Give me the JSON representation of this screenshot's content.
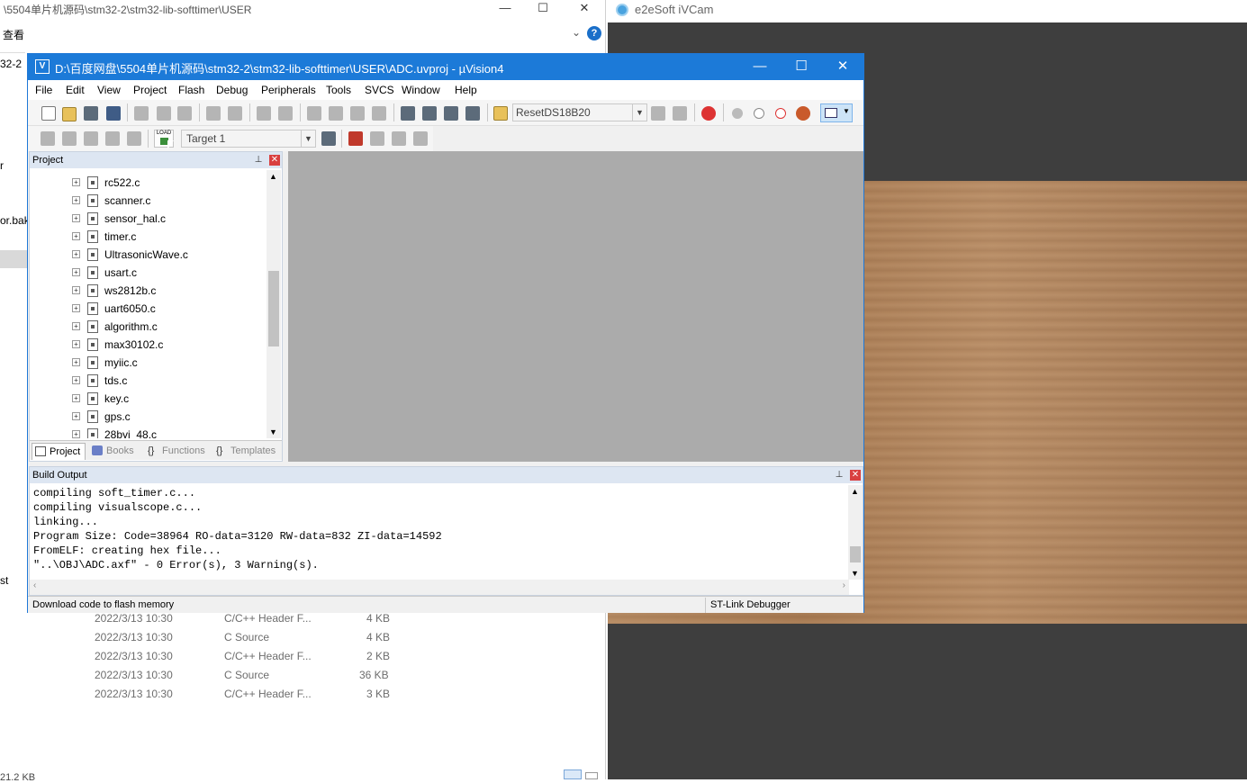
{
  "explorer": {
    "title": "\\5504单片机源码\\stm32-2\\stm32-lib-softtimer\\USER",
    "ribbon_view": "查看",
    "sidebar_fragments": [
      "32-2",
      "r",
      "or.bak",
      "st"
    ],
    "files": [
      {
        "date": "2022/3/13 10:30",
        "type": "C/C++ Header F...",
        "size": "4 KB"
      },
      {
        "date": "2022/3/13 10:30",
        "type": "C Source",
        "size": "4 KB"
      },
      {
        "date": "2022/3/13 10:30",
        "type": "C/C++ Header F...",
        "size": "2 KB"
      },
      {
        "date": "2022/3/13 10:30",
        "type": "C Source",
        "size": "36 KB"
      },
      {
        "date": "2022/3/13 10:30",
        "type": "C/C++ Header F...",
        "size": "3 KB"
      }
    ],
    "bottom_status": "21.2 KB"
  },
  "camera": {
    "title": "e2eSoft iVCam"
  },
  "uvision": {
    "title": "D:\\百度网盘\\5504单片机源码\\stm32-2\\stm32-lib-softtimer\\USER\\ADC.uvproj - µVision4",
    "menu": [
      "File",
      "Edit",
      "View",
      "Project",
      "Flash",
      "Debug",
      "Peripherals",
      "Tools",
      "SVCS",
      "Window",
      "Help"
    ],
    "find_combo": "ResetDS18B20",
    "target_combo": "Target 1",
    "project_pane": {
      "title": "Project",
      "files": [
        "rc522.c",
        "scanner.c",
        "sensor_hal.c",
        "timer.c",
        "UltrasonicWave.c",
        "usart.c",
        "ws2812b.c",
        "uart6050.c",
        "algorithm.c",
        "max30102.c",
        "myiic.c",
        "tds.c",
        "key.c",
        "gps.c",
        "28byj_48.c"
      ],
      "tabs": [
        "Project",
        "Books",
        "Functions",
        "Templates"
      ]
    },
    "build_output": {
      "title": "Build Output",
      "lines": [
        "compiling soft_timer.c...",
        "compiling visualscope.c...",
        "linking...",
        "Program Size: Code=38964 RO-data=3120 RW-data=832 ZI-data=14592",
        "FromELF: creating hex file...",
        "\"..\\OBJ\\ADC.axf\" - 0 Error(s), 3 Warning(s)."
      ]
    },
    "status_left": "Download code to flash memory",
    "status_right": "ST-Link Debugger"
  }
}
